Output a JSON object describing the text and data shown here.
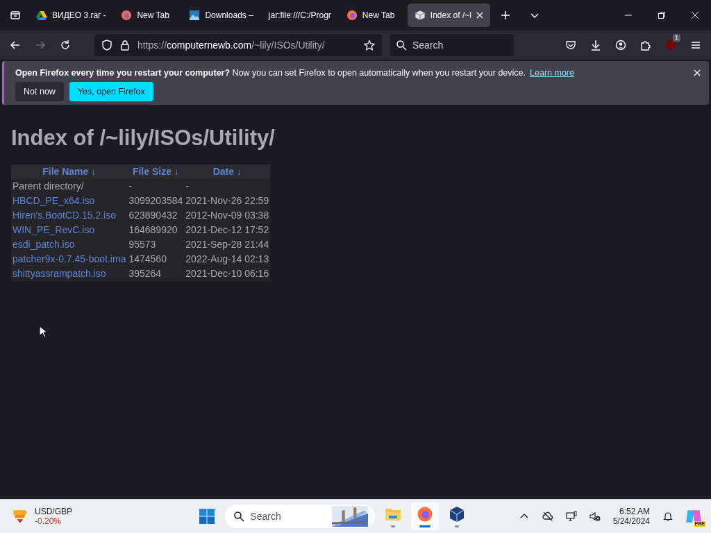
{
  "tabs": [
    {
      "label": "ВИДЕО 3.rar -",
      "selected": false
    },
    {
      "label": "New Tab",
      "selected": false
    },
    {
      "label": "Downloads –",
      "selected": false
    },
    {
      "label": "jar:file:///C:/Progr",
      "selected": false
    },
    {
      "label": "New Tab",
      "selected": false
    },
    {
      "label": "Index of /~l",
      "selected": true
    }
  ],
  "address": {
    "prefix": "https://",
    "host": "computernewb.com",
    "path": "/~lily/ISOs/Utility/"
  },
  "search": {
    "placeholder": "Search"
  },
  "extensions_badge": "1",
  "notification": {
    "text": "**Open Firefox every time you restart your computer?** Now you can set Firefox to open automatically when you restart your device.",
    "link": "Learn more",
    "buttons": [
      {
        "label": "Not now",
        "kind": "secondary"
      },
      {
        "label": "Yes, open Firefox",
        "kind": "primary"
      }
    ]
  },
  "page": {
    "heading": "Index of /~lily/ISOs/Utility/",
    "columns": [
      "File Name  ↓",
      "File Size  ↓",
      "Date  ↓"
    ],
    "rows": [
      {
        "kind": "parent",
        "name": "Parent directory/",
        "size": "-",
        "date": "-"
      },
      {
        "kind": "file",
        "name": "HBCD_PE_x64.iso",
        "size": "3099203584",
        "date": "2021-Nov-26 22:59"
      },
      {
        "kind": "file",
        "name": "Hiren's.BootCD.15.2.iso",
        "size": "623890432",
        "date": "2012-Nov-09 03:38"
      },
      {
        "kind": "file",
        "name": "WIN_PE_RevC.iso",
        "size": "164689920",
        "date": "2021-Dec-12 17:52"
      },
      {
        "kind": "file",
        "name": "esdi_patch.iso",
        "size": "95573",
        "date": "2021-Sep-28 21:44"
      },
      {
        "kind": "file",
        "name": "patcher9x-0.7.45-boot.ima",
        "size": "1474560",
        "date": "2022-Aug-14 02:13"
      },
      {
        "kind": "file",
        "name": "shittyassrampatch.iso",
        "size": "395264",
        "date": "2021-Dec-10 06:16"
      }
    ]
  },
  "taskbar": {
    "widget": {
      "title": "USD/GBP",
      "change": "-0.20%"
    },
    "search": {
      "placeholder": "Search"
    },
    "apps": [
      {
        "selected": false
      },
      {
        "selected": true
      },
      {
        "selected": false
      }
    ],
    "time": "6:52 AM",
    "date": "5/24/2024",
    "copilot_badge": "PRE"
  }
}
